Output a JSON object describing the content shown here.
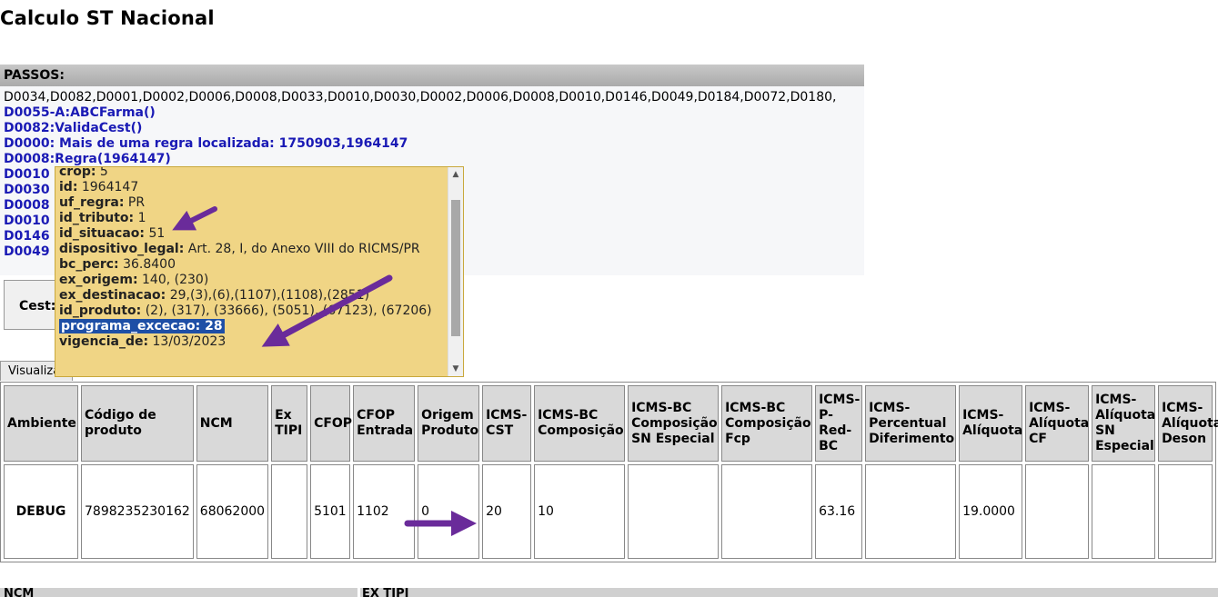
{
  "page_title": "Calculo ST Nacional",
  "passos": {
    "header": "PASSOS:",
    "codes_line": "D0034,D0082,D0001,D0002,D0006,D0008,D0033,D0010,D0030,D0002,D0006,D0008,D0010,D0146,D0049,D0184,D0072,D0180,",
    "steps": [
      "D0055-A:ABCFarma()",
      "D0082:ValidaCest()",
      "D0000: Mais de uma regra localizada: 1750903,1964147",
      "D0008:Regra(1964147)",
      "D0010",
      "D0030",
      "D0008",
      "D0010",
      "D0146",
      "D0049"
    ]
  },
  "cest_label": "Cest:",
  "visualizar_button": "Visualizar",
  "tooltip": {
    "lines": [
      {
        "key": "crop:",
        "value": " 5"
      },
      {
        "key": "id:",
        "value": " 1964147"
      },
      {
        "key": "uf_regra:",
        "value": " PR"
      },
      {
        "key": "id_tributo:",
        "value": " 1"
      },
      {
        "key": "id_situacao:",
        "value": " 51"
      },
      {
        "key": "dispositivo_legal:",
        "value": " Art. 28, I, do Anexo VIII do RICMS/PR"
      },
      {
        "key": "bc_perc:",
        "value": " 36.8400"
      },
      {
        "key": "ex_origem:",
        "value": " 140, (230)"
      },
      {
        "key": "ex_destinacao:",
        "value": " 29,(3),(6),(1107),(1108),(2851)"
      },
      {
        "key": "id_produto:",
        "value": " (2), (317), (33666), (5051), (67123), (67206)"
      }
    ],
    "highlighted": "programa_excecao: 28",
    "last_key": "vigencia_de:",
    "last_value": " 13/03/2023",
    "scroll_up": "▲",
    "scroll_down": "▼"
  },
  "table": {
    "headers": [
      "Ambiente",
      "Código de produto",
      "NCM",
      "Ex TIPI",
      "CFOP",
      "CFOP Entrada",
      "Origem Produto",
      "ICMS-CST",
      "ICMS-BC Composição",
      "ICMS-BC Composição SN Especial",
      "ICMS-BC Composição Fcp",
      "ICMS-P-Red-BC",
      "ICMS-Percentual Diferimento",
      "ICMS-Alíquota",
      "ICMS-Alíquota CF",
      "ICMS-Alíquota SN Especial",
      "ICMS-Alíquota Deson"
    ],
    "row": [
      "DEBUG",
      "7898235230162",
      "68062000",
      "",
      "5101",
      "1102",
      "0",
      "20",
      "10",
      "",
      "",
      "63.16",
      "",
      "19.0000",
      "",
      "",
      ""
    ]
  },
  "bottom": {
    "col1": "NCM",
    "col2": "EX TIPI"
  },
  "colors": {
    "arrow": "#6a2b9a",
    "tooltip_bg": "#f0d585",
    "step_blue": "#1a1ab5",
    "highlight": "#1e4fa6"
  }
}
